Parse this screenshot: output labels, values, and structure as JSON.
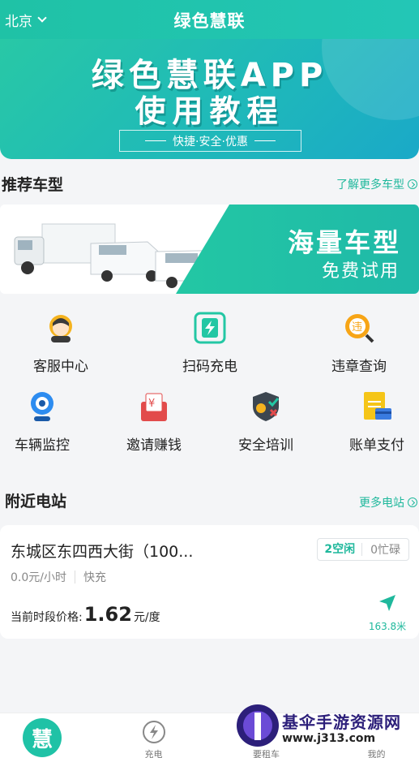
{
  "header": {
    "city": "北京",
    "title": "绿色慧联"
  },
  "hero": {
    "title": "绿色慧联APP",
    "subtitle": "使用教程",
    "tagline": "快捷·安全·优惠"
  },
  "recommend": {
    "title": "推荐车型",
    "more": "了解更多车型"
  },
  "promo": {
    "title": "海量车型",
    "subtitle": "免费试用"
  },
  "grid": [
    {
      "label": "客服中心",
      "icon": "customer-service-icon"
    },
    {
      "label": "扫码充电",
      "icon": "scan-charge-icon"
    },
    {
      "label": "违章查询",
      "icon": "violation-query-icon"
    },
    {
      "label": "车辆监控",
      "icon": "camera-icon"
    },
    {
      "label": "邀请赚钱",
      "icon": "invite-money-icon"
    },
    {
      "label": "安全培训",
      "icon": "safety-training-icon"
    },
    {
      "label": "账单支付",
      "icon": "bill-payment-icon"
    }
  ],
  "nearby": {
    "title": "附近电站",
    "more": "更多电站"
  },
  "station": {
    "name": "东城区东四西大街（100...",
    "free": "2空闲",
    "busy": "0忙碌",
    "price_unit": "0.0元/小时",
    "charge_type": "快充",
    "price_label": "当前时段价格:",
    "price_value": "1.62",
    "price_suffix": "元/度",
    "distance": "163.8米"
  },
  "tabbar": {
    "home_glyph": "慧",
    "charge": "充电",
    "rent": "要租车",
    "mine": "我的"
  },
  "watermark": {
    "text": "基伞手游资源网",
    "url": "www.j313.com"
  },
  "colors": {
    "brand": "#1fc2a6",
    "accent_text": "#1fb89c"
  }
}
